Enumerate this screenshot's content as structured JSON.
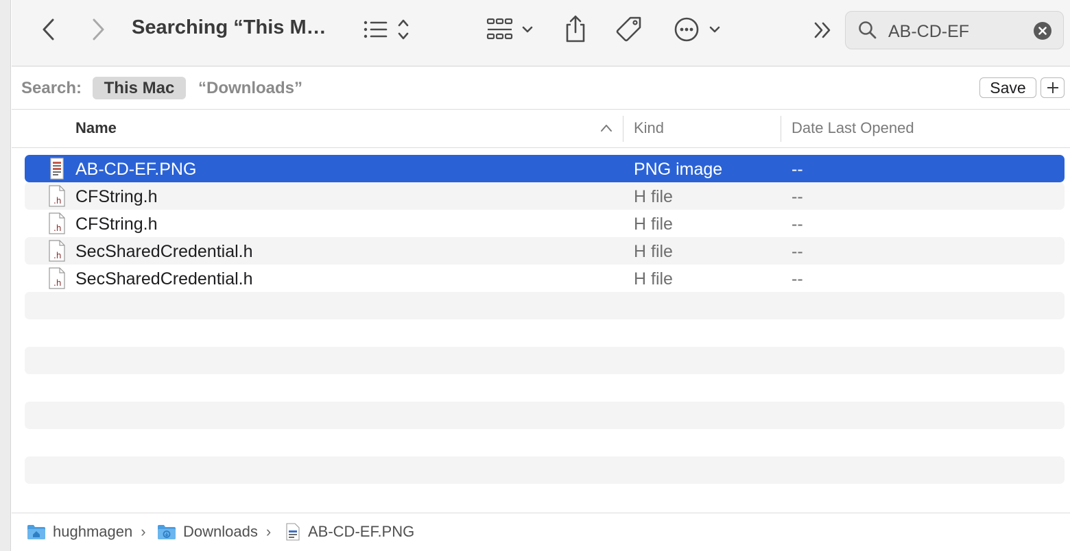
{
  "toolbar": {
    "title": "Searching “This M…"
  },
  "search": {
    "query": "AB-CD-EF"
  },
  "scope_bar": {
    "label": "Search:",
    "this_mac": "This Mac",
    "downloads": "“Downloads”",
    "save": "Save"
  },
  "columns": {
    "name": "Name",
    "kind": "Kind",
    "date": "Date Last Opened"
  },
  "files": [
    {
      "name": "AB-CD-EF.PNG",
      "kind": "PNG image",
      "date": "--",
      "icon": "png-file-icon",
      "selected": true
    },
    {
      "name": "CFString.h",
      "kind": "H file",
      "date": "--",
      "icon": "h-file-icon"
    },
    {
      "name": "CFString.h",
      "kind": "H file",
      "date": "--",
      "icon": "h-file-icon"
    },
    {
      "name": "SecSharedCredential.h",
      "kind": "H file",
      "date": "--",
      "icon": "h-file-icon"
    },
    {
      "name": "SecSharedCredential.h",
      "kind": "H file",
      "date": "--",
      "icon": "h-file-icon"
    }
  ],
  "path_bar": {
    "items": [
      "hughmagen",
      "Downloads",
      "AB-CD-EF.PNG"
    ]
  },
  "colors": {
    "selection": "#2a62d6",
    "folder": "#4a9ee0"
  }
}
